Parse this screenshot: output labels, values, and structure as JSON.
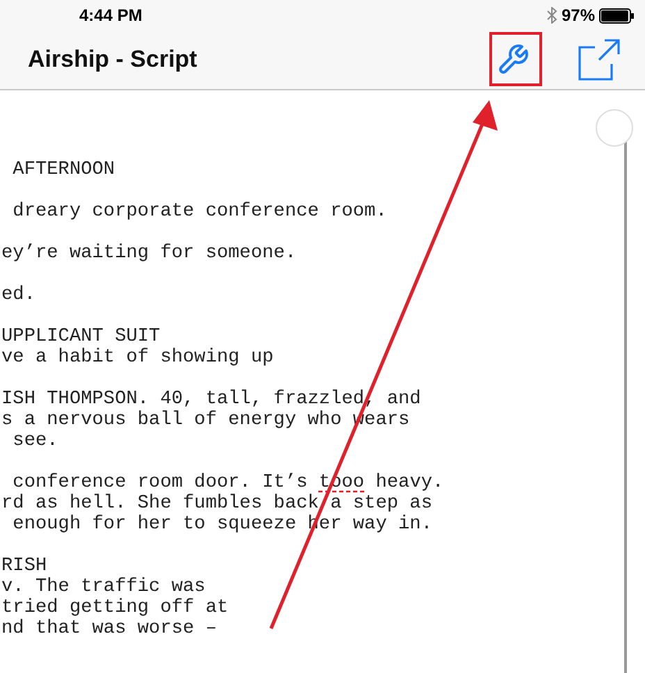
{
  "status_bar": {
    "time": "4:44 PM",
    "battery": "97%"
  },
  "nav_bar": {
    "title": "Airship - Script"
  },
  "paragraphs": [
    {
      "lines": [
        {
          "spans": [
            {
              "text": " AFTERNOON"
            }
          ]
        }
      ]
    },
    {
      "lines": [
        {
          "spans": [
            {
              "text": " dreary corporate conference room."
            }
          ]
        }
      ]
    },
    {
      "lines": [
        {
          "spans": [
            {
              "text": "ey’re waiting for someone."
            }
          ]
        }
      ]
    },
    {
      "lines": [
        {
          "spans": [
            {
              "text": "ed."
            }
          ]
        }
      ]
    },
    {
      "lines": [
        {
          "spans": [
            {
              "text": "UPPLICANT SUIT"
            }
          ]
        },
        {
          "spans": [
            {
              "text": "ve a habit of showing up"
            }
          ]
        }
      ]
    },
    {
      "lines": [
        {
          "spans": [
            {
              "text": "ISH THOMPSON. 40, tall, frazzled, and"
            }
          ]
        },
        {
          "spans": [
            {
              "text": "s a nervous ball of energy who wears"
            }
          ]
        },
        {
          "spans": [
            {
              "text": " see."
            }
          ]
        }
      ]
    },
    {
      "lines": [
        {
          "spans": [
            {
              "text": " conference room door. It’s "
            },
            {
              "text": "tooo",
              "misspelled": true
            },
            {
              "text": " heavy."
            }
          ]
        },
        {
          "spans": [
            {
              "text": "rd as hell. She fumbles back a step as"
            }
          ]
        },
        {
          "spans": [
            {
              "text": " enough for her to squeeze her way in."
            }
          ]
        }
      ]
    },
    {
      "lines": [
        {
          "spans": [
            {
              "text": "RISH"
            }
          ]
        },
        {
          "spans": [
            {
              "text": "v. The traffic was"
            }
          ]
        },
        {
          "spans": [
            {
              "text": "tried getting off at"
            }
          ]
        },
        {
          "spans": [
            {
              "text": "nd that was worse –"
            }
          ]
        }
      ]
    }
  ]
}
